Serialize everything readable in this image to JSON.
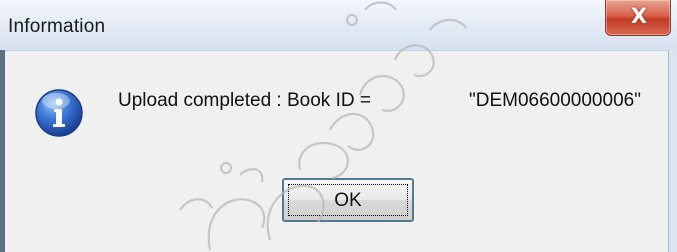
{
  "window": {
    "title": "Information",
    "close_glyph": "X"
  },
  "message": {
    "text": "Upload completed : Book ID =",
    "book_id": "\"DEM06600000006\""
  },
  "icon": {
    "name": "info-icon",
    "glyph": "i",
    "color": "#2d63c8"
  },
  "buttons": {
    "ok_label": "OK"
  },
  "watermark": {
    "color": "#b8b8b8"
  }
}
